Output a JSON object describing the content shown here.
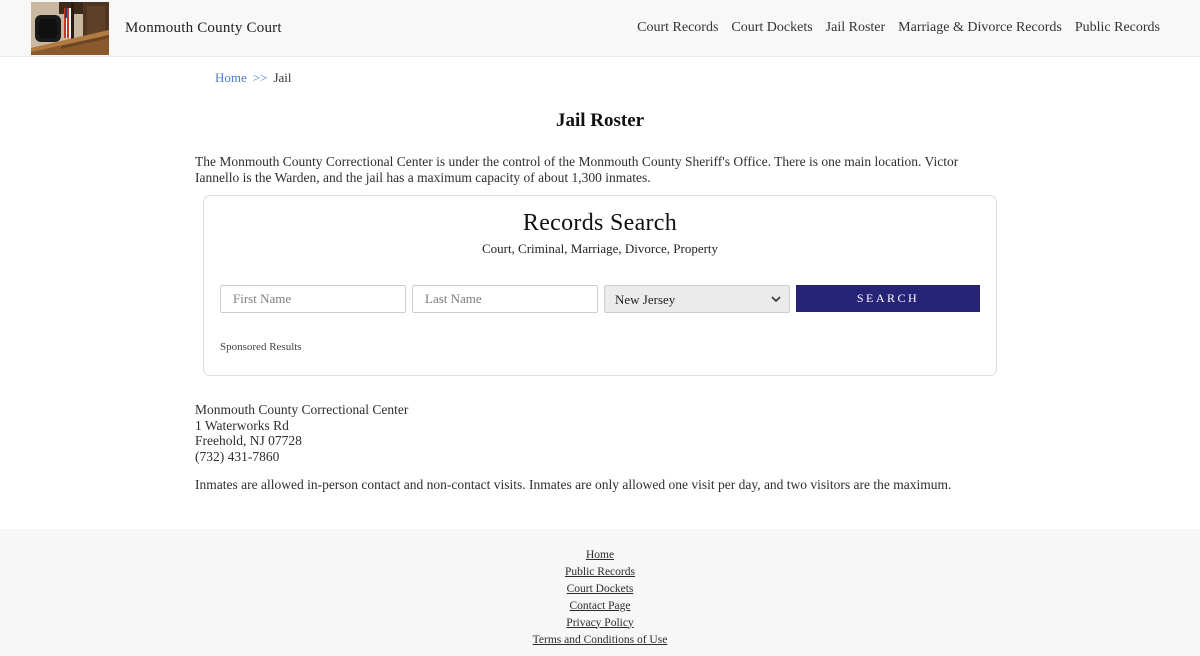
{
  "header": {
    "site_title": "Monmouth County Court",
    "nav": [
      {
        "label": "Court Records"
      },
      {
        "label": "Court Dockets"
      },
      {
        "label": "Jail Roster"
      },
      {
        "label": "Marriage & Divorce Records"
      },
      {
        "label": "Public Records"
      }
    ]
  },
  "breadcrumb": {
    "home": "Home",
    "separator": ">>",
    "current": "Jail"
  },
  "page": {
    "title": "Jail Roster",
    "intro": "The Monmouth County Correctional Center is under the control of the Monmouth County Sheriff's Office. There is one main location. Victor Iannello is the Warden, and the jail has a maximum capacity of about 1,300 inmates."
  },
  "search_box": {
    "title": "Records Search",
    "subtitle": "Court, Criminal, Marriage, Divorce, Property",
    "first_name_placeholder": "First Name",
    "last_name_placeholder": "Last Name",
    "state_selected": "New Jersey",
    "search_button": "SEARCH",
    "sponsored": "Sponsored Results"
  },
  "facility": {
    "name": "Monmouth County Correctional Center",
    "address_line1": "1 Waterworks Rd",
    "address_line2": "Freehold, NJ 07728",
    "phone": "(732) 431-7860"
  },
  "visits_note": "Inmates are allowed in-person contact and non-contact visits. Inmates are only allowed one visit per day, and two visitors are the maximum.",
  "footer": {
    "links": [
      "Home",
      "Public Records",
      "Court Dockets",
      "Contact Page",
      "Privacy Policy",
      "Terms and Conditions of Use"
    ]
  },
  "colors": {
    "accent_navy": "#272377",
    "link_blue": "#4a7dc9",
    "header_bg": "#f8f8f8",
    "footer_bg": "#f7f7f7"
  }
}
